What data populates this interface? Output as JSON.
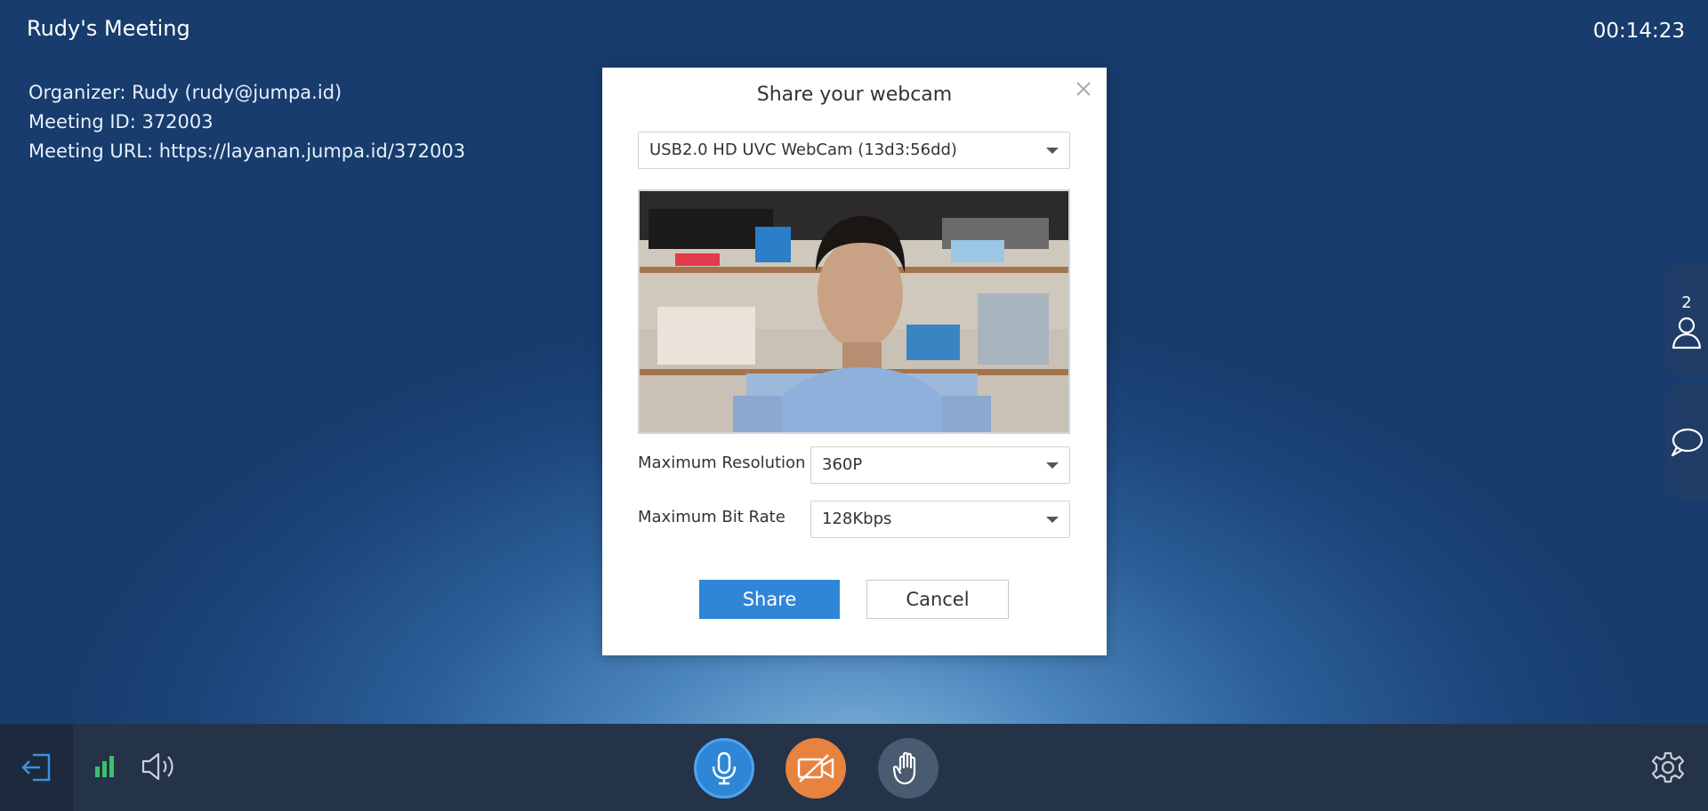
{
  "meeting": {
    "title": "Rudy's Meeting",
    "timer": "00:14:23",
    "organizer": "Organizer: Rudy (rudy@jumpa.id)",
    "meeting_id": "Meeting ID: 372003",
    "meeting_url": "Meeting URL: https://layanan.jumpa.id/372003"
  },
  "side": {
    "participant_count": "2",
    "participants_icon": "person-icon",
    "chat_icon": "chat-bubble-icon"
  },
  "dialog": {
    "title": "Share your webcam",
    "camera_device": "USB2.0 HD UVC WebCam (13d3:56dd)",
    "resolution_label": "Maximum Resolution",
    "resolution_value": "360P",
    "bitrate_label": "Maximum Bit Rate",
    "bitrate_value": "128Kbps",
    "share_label": "Share",
    "cancel_label": "Cancel"
  },
  "toolbar": {
    "leave_icon": "exit-icon",
    "signal_icon": "signal-bars-icon",
    "speaker_icon": "speaker-icon",
    "mic_icon": "microphone-icon",
    "camera_icon": "camera-off-icon",
    "hand_icon": "raise-hand-icon",
    "settings_icon": "gear-icon"
  },
  "colors": {
    "accent": "#2f86d6",
    "camera_off": "#e8823f",
    "signal": "#3fbf6b",
    "bar": "#253349"
  }
}
